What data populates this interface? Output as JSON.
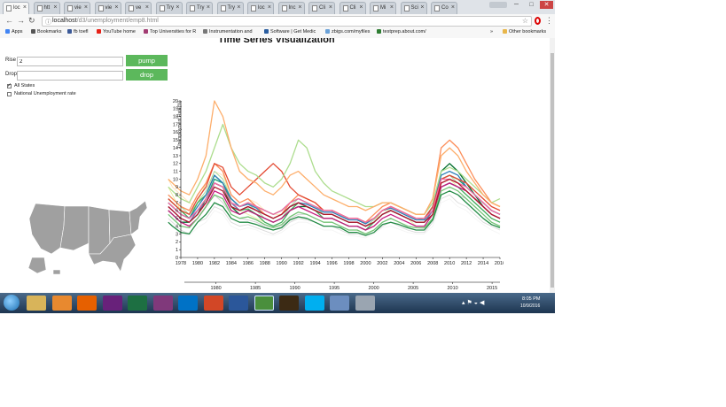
{
  "browser": {
    "tabs": [
      {
        "label": "loc",
        "active": true
      },
      {
        "label": "htt",
        "active": false
      },
      {
        "label": "vie",
        "active": false
      },
      {
        "label": "vie",
        "active": false
      },
      {
        "label": "ve",
        "active": false
      },
      {
        "label": "Try",
        "active": false
      },
      {
        "label": "Try",
        "active": false
      },
      {
        "label": "Try",
        "active": false
      },
      {
        "label": "loc",
        "active": false
      },
      {
        "label": "Inc",
        "active": false
      },
      {
        "label": "Cli",
        "active": false
      },
      {
        "label": "Cli",
        "active": false
      },
      {
        "label": "Mi",
        "active": false
      },
      {
        "label": "Sci",
        "active": false
      },
      {
        "label": "Co",
        "active": false
      }
    ],
    "url_host": "localhost",
    "url_path": "/d3/unemployment/emp8.html",
    "bookmarks": [
      {
        "label": "Apps",
        "color": "#4285f4"
      },
      {
        "label": "Bookmarks",
        "color": "#555555"
      },
      {
        "label": "fb toefl",
        "color": "#3b5998"
      },
      {
        "label": "YouTube home",
        "color": "#e62117"
      },
      {
        "label": "Top Universities for R",
        "color": "#a23b72"
      },
      {
        "label": "Instrumentation and",
        "color": "#777777"
      },
      {
        "label": "Software | Get Medic",
        "color": "#2a5d9f"
      },
      {
        "label": "zbigs.com/myfiles",
        "color": "#6aa1d8"
      },
      {
        "label": "testprep.about.com/",
        "color": "#2e7d32"
      }
    ],
    "more_bookmarks": "»",
    "other_bookmarks": "Other bookmarks"
  },
  "page": {
    "title": "Time Series Visualization",
    "rise_label": "Rise",
    "rise_value": "2",
    "drop_label": "Drop",
    "drop_value": "",
    "pump_label": "pump",
    "drop_button_label": "drop",
    "all_states_label": "All States",
    "all_states_checked": true,
    "national_label": "National Unemployment rate",
    "national_checked": false
  },
  "chart_data": {
    "type": "line",
    "ylabel": "Unemployment Rate(%)",
    "ylim": [
      0,
      20
    ],
    "xlim": [
      1978,
      2016
    ],
    "x_ticks": [
      "1978",
      "1980",
      "1982",
      "1984",
      "1986",
      "1988",
      "1990",
      "1992",
      "1994",
      "1996",
      "1998",
      "2000",
      "2002",
      "2004",
      "2006",
      "2008",
      "2010",
      "2012",
      "2014",
      "2016"
    ],
    "y_ticks": [
      "0",
      "1",
      "2",
      "3",
      "4",
      "5",
      "6",
      "7",
      "8",
      "9",
      "10",
      "11",
      "12",
      "13",
      "14",
      "15",
      "16",
      "17",
      "18",
      "19",
      "20"
    ],
    "x": [
      1976.5,
      1977,
      1978,
      1979,
      1980,
      1981,
      1982,
      1983,
      1984,
      1985,
      1986,
      1987,
      1988,
      1989,
      1990,
      1991,
      1992,
      1993,
      1994,
      1995,
      1996,
      1997,
      1998,
      1999,
      2000,
      2001,
      2002,
      2003,
      2004,
      2005,
      2006,
      2007,
      2008,
      2009,
      2010,
      2011,
      2012,
      2013,
      2014,
      2015,
      2016
    ],
    "series": [
      {
        "color": "#ffe0b3",
        "values": [
          10,
          9,
          8,
          7,
          6.5,
          8,
          11,
          10.5,
          8,
          7,
          7.5,
          7,
          6,
          5.5,
          5.5,
          6.5,
          7,
          6.5,
          6,
          5.5,
          5.5,
          5,
          4.5,
          4.5,
          4,
          4.5,
          5.5,
          6,
          5.5,
          5,
          4.5,
          4.5,
          6,
          10,
          10.5,
          9.5,
          8.5,
          7.5,
          6.5,
          5.5,
          5
        ]
      },
      {
        "color": "#e8f0a0",
        "values": [
          9,
          8,
          6,
          5.5,
          7,
          9.5,
          12,
          11,
          7,
          6,
          5.5,
          5,
          4.5,
          4,
          4.5,
          6,
          7,
          6.5,
          6,
          5,
          5,
          4.5,
          4,
          4,
          3.5,
          4.5,
          6,
          6,
          5.5,
          5,
          4,
          4,
          5.5,
          9.5,
          10,
          9,
          8,
          7,
          6,
          5,
          4.5
        ]
      },
      {
        "color": "#cfcfcf",
        "values": [
          6,
          5.5,
          4.5,
          4,
          5,
          6.5,
          8,
          7,
          5.5,
          5,
          4.8,
          4.5,
          4,
          3.5,
          4,
          5,
          5.5,
          5.5,
          5,
          4.5,
          4.5,
          4,
          3.5,
          3.5,
          3,
          3.5,
          4.5,
          5,
          4.5,
          4,
          3.8,
          3.7,
          5,
          8,
          8.5,
          8,
          7.5,
          6.5,
          5.5,
          4.5,
          4
        ]
      },
      {
        "color": "#d9d9d9",
        "values": [
          5,
          4.5,
          3.5,
          3,
          4.5,
          5,
          6.5,
          6,
          4.5,
          4,
          4.2,
          3.8,
          3.4,
          3,
          3.5,
          4.5,
          5,
          4.8,
          4.5,
          4,
          4,
          3.5,
          3,
          3,
          2.8,
          3.2,
          4,
          4.5,
          4,
          3.5,
          3.2,
          3.2,
          4.5,
          7.5,
          8,
          7,
          6.5,
          5.5,
          4.5,
          4,
          3.5
        ]
      },
      {
        "color": "#f4f4f4",
        "values": [
          4.5,
          4,
          3,
          2.8,
          3.8,
          4.5,
          6,
          5.5,
          4,
          3.5,
          3.8,
          3.5,
          3,
          2.8,
          3.2,
          4,
          4.5,
          4.5,
          4,
          3.5,
          3.5,
          3,
          2.8,
          2.7,
          2.5,
          3,
          3.8,
          4,
          3.6,
          3.2,
          3,
          3,
          4,
          7,
          7.5,
          6.5,
          6,
          5,
          4.2,
          3.5,
          3
        ]
      },
      {
        "color": "#a1d99b",
        "values": [
          8,
          7.5,
          6.5,
          5.5,
          7,
          8.5,
          11,
          10,
          7.5,
          6.5,
          6.8,
          6,
          5,
          4.5,
          5,
          6.5,
          7.5,
          7,
          6.5,
          5.5,
          5.5,
          5,
          4.5,
          4.5,
          4,
          4.8,
          6,
          6.5,
          6,
          5.5,
          5,
          4.8,
          6,
          10,
          10.5,
          9.5,
          8.5,
          7.5,
          6.5,
          5.5,
          5
        ]
      },
      {
        "color": "#41ab5d",
        "values": [
          7.5,
          7,
          6,
          5,
          7,
          8,
          10.5,
          9.5,
          7,
          6,
          6.2,
          5.5,
          4.5,
          4,
          4.5,
          6,
          7,
          6.5,
          6,
          5,
          5,
          4.5,
          4,
          4,
          3.5,
          4.5,
          5.5,
          6,
          5.5,
          5,
          4.5,
          4.5,
          5.5,
          9,
          9.5,
          9,
          8,
          7,
          6,
          5,
          4.5
        ]
      },
      {
        "color": "#006d2c",
        "values": [
          6,
          5.5,
          4.5,
          4.5,
          5.5,
          7.5,
          9.5,
          9,
          6.5,
          5.5,
          6,
          5.5,
          5,
          4.5,
          5,
          6,
          6.5,
          6.5,
          6,
          5.5,
          5.5,
          5,
          4.5,
          4.5,
          4,
          4.5,
          5.5,
          6,
          5.5,
          5,
          4.5,
          4.5,
          6,
          11,
          12,
          11,
          9.5,
          8,
          6.5,
          5.5,
          5
        ]
      },
      {
        "color": "#1b9e77",
        "values": [
          7,
          6.5,
          5.5,
          5,
          6,
          7.5,
          10,
          9.5,
          7.5,
          6.5,
          7,
          6.5,
          6,
          5.5,
          6,
          7,
          7.5,
          7,
          6.5,
          6,
          6,
          5.5,
          5,
          5,
          4.5,
          5,
          6,
          6.5,
          6,
          5.5,
          5,
          5,
          6.5,
          10,
          10.5,
          10,
          9,
          8,
          7,
          6,
          5.5
        ]
      },
      {
        "color": "#7570b3",
        "values": [
          6.5,
          6,
          5,
          4.5,
          6,
          7,
          9.5,
          9,
          7,
          6,
          6.5,
          6,
          5.5,
          5,
          5.5,
          6.5,
          7,
          6.5,
          6,
          5.5,
          5.5,
          5,
          4.5,
          4.5,
          4,
          4.5,
          5.5,
          6,
          5.5,
          5,
          4.5,
          4.5,
          6,
          9,
          9.5,
          9,
          8.5,
          7.5,
          6.5,
          5.5,
          5
        ]
      },
      {
        "color": "#2c7fb8",
        "values": [
          7,
          6.5,
          5.5,
          5,
          6.5,
          8,
          10.5,
          9.5,
          7.5,
          6.5,
          6.8,
          6.3,
          5.5,
          5,
          5.5,
          6.5,
          7,
          6.8,
          6.3,
          5.8,
          5.8,
          5.3,
          4.8,
          4.8,
          4.3,
          5,
          6,
          6.3,
          5.8,
          5.3,
          4.8,
          4.8,
          6.5,
          10.5,
          11,
          10.5,
          9,
          8,
          7,
          6,
          5.5
        ]
      },
      {
        "color": "#fc8d59",
        "values": [
          8,
          7.5,
          6.5,
          6,
          8,
          9.5,
          12,
          11,
          8,
          7,
          7.5,
          6.5,
          5.5,
          5,
          5.5,
          7,
          8,
          7.5,
          7,
          6,
          6,
          5.5,
          5,
          5,
          4.5,
          5.5,
          6.5,
          7,
          6.5,
          6,
          5.5,
          5.5,
          7.5,
          14,
          15,
          14,
          12,
          10,
          8.5,
          7,
          6.5
        ]
      },
      {
        "color": "#e34a33",
        "values": [
          7.5,
          7,
          6,
          5.5,
          7.5,
          9,
          12,
          11.5,
          9,
          8,
          9,
          10,
          11,
          12,
          11,
          9,
          8,
          7.5,
          7,
          6,
          6,
          5.5,
          5,
          5,
          4.5,
          5,
          6,
          6.5,
          6,
          5.5,
          5,
          5,
          6.5,
          10,
          10.5,
          10,
          9.5,
          8.5,
          7.5,
          6.5,
          6
        ]
      },
      {
        "color": "#f768a1",
        "values": [
          7,
          6.5,
          5.5,
          5,
          6,
          7.5,
          9.5,
          9,
          7,
          6.5,
          7,
          6.5,
          6,
          5.5,
          6,
          7,
          7.5,
          7,
          6.5,
          6,
          6,
          5.5,
          5,
          5,
          4.5,
          5,
          6,
          6.5,
          6,
          5.5,
          5,
          5,
          6,
          10,
          10,
          9.5,
          9,
          8,
          7,
          6,
          5.5
        ]
      },
      {
        "color": "#c51b7d",
        "values": [
          6,
          5.5,
          4.5,
          4,
          5,
          6.5,
          8.5,
          8,
          6,
          5.5,
          6,
          5.5,
          5,
          4.5,
          5,
          6,
          6.5,
          6,
          5.5,
          5,
          5,
          4.5,
          4,
          4,
          3.5,
          4,
          5,
          5.5,
          5,
          4.5,
          4,
          4,
          5.5,
          9,
          9.5,
          9,
          8.5,
          7.5,
          6.5,
          5.5,
          5
        ]
      },
      {
        "color": "#b2182b",
        "values": [
          6.5,
          6,
          5,
          4.5,
          5.5,
          7,
          9,
          8.5,
          6.5,
          6,
          6.5,
          6,
          5.5,
          5,
          5.5,
          6.5,
          7,
          6.5,
          6,
          5.5,
          5.5,
          5,
          4.5,
          4.5,
          4,
          4.5,
          5.5,
          6,
          5.5,
          5,
          4.5,
          4.5,
          5.5,
          9.5,
          10,
          9.5,
          8.5,
          7.5,
          6.5,
          5.5,
          5
        ]
      },
      {
        "color": "#addd8e",
        "values": [
          9,
          8.5,
          7.5,
          7,
          9,
          11,
          14,
          17,
          14,
          12,
          11,
          10.5,
          9.5,
          9,
          10,
          12,
          15,
          14,
          11,
          9.5,
          8.5,
          8,
          7.5,
          7,
          6.5,
          6.5,
          7,
          7,
          6.5,
          6,
          5.5,
          5.5,
          7,
          11,
          11.5,
          11,
          10,
          9,
          8,
          7,
          7.5
        ]
      },
      {
        "color": "#fdae6b",
        "values": [
          10,
          9.5,
          8.5,
          8,
          10,
          13,
          20,
          18,
          14,
          11,
          10,
          9.5,
          8.5,
          8,
          9,
          10.5,
          11,
          10,
          9,
          8,
          7.5,
          7,
          6.5,
          6.5,
          6,
          6.5,
          7,
          7,
          6.5,
          6,
          5.5,
          5.5,
          7.5,
          13,
          14,
          13,
          11,
          9.5,
          8,
          7,
          6.5
        ]
      },
      {
        "color": "#74c476",
        "values": [
          5.5,
          5,
          4,
          3.8,
          5,
          6.5,
          8,
          7.5,
          5.5,
          5,
          5.2,
          4.8,
          4.2,
          3.8,
          4.2,
          5.2,
          5.8,
          5.5,
          5,
          4.5,
          4.5,
          4,
          3.5,
          3.5,
          3,
          3.5,
          4.5,
          5,
          4.5,
          4,
          3.8,
          3.8,
          5,
          8.5,
          9,
          8.5,
          7.5,
          6.5,
          5.5,
          4.5,
          4
        ]
      },
      {
        "color": "#238b45",
        "values": [
          4.5,
          4,
          3.2,
          3,
          4.5,
          5.5,
          7,
          6.5,
          5,
          4.5,
          4.5,
          4.2,
          3.8,
          3.5,
          3.8,
          4.8,
          5.2,
          5,
          4.5,
          4,
          4,
          3.8,
          3.2,
          3.2,
          2.8,
          3.2,
          4.2,
          4.5,
          4.2,
          3.8,
          3.5,
          3.5,
          4.8,
          8,
          8.5,
          8,
          7,
          6,
          5,
          4.2,
          3.8
        ]
      }
    ],
    "brush": {
      "ticks": [
        "1980",
        "1985",
        "1990",
        "1995",
        "2000",
        "2005",
        "2010",
        "2015"
      ],
      "xlim": [
        1976,
        2016
      ]
    },
    "map": {
      "fill": "#a0a0a0"
    }
  },
  "taskbar": {
    "time": "8:05 PM",
    "date": "10/9/2016",
    "apps": [
      {
        "name": "explorer",
        "color": "#d8b45a"
      },
      {
        "name": "media-player",
        "color": "#e8892f"
      },
      {
        "name": "firefox",
        "color": "#e66000"
      },
      {
        "name": "visual-studio",
        "color": "#68217a"
      },
      {
        "name": "excel",
        "color": "#1d6f42"
      },
      {
        "name": "onenote",
        "color": "#80397b"
      },
      {
        "name": "outlook",
        "color": "#0072c6"
      },
      {
        "name": "powerpoint",
        "color": "#d24726"
      },
      {
        "name": "word",
        "color": "#2b579a"
      },
      {
        "name": "chrome",
        "color": "#4a8f3c"
      },
      {
        "name": "terminal",
        "color": "#3c2a14"
      },
      {
        "name": "skype",
        "color": "#00aff0"
      },
      {
        "name": "notes-app",
        "color": "#6c8ebf"
      },
      {
        "name": "settings-app",
        "color": "#9aa5b1"
      }
    ]
  }
}
